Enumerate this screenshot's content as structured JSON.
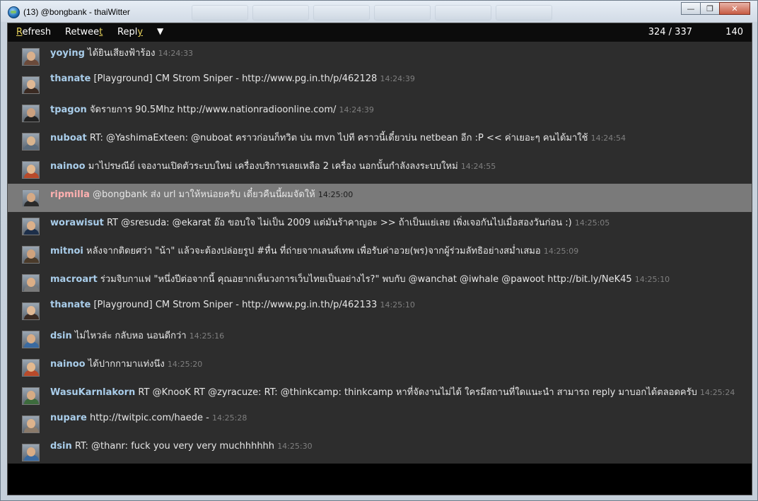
{
  "window": {
    "title": "(13) @bongbank - thaiWitter"
  },
  "toolbar": {
    "refresh": {
      "accel": "R",
      "rest": "efresh"
    },
    "retweet": {
      "pre": "Retwee",
      "accel": "t"
    },
    "reply": {
      "pre": "Repl",
      "accel": "y"
    },
    "menu_glyph": "▼",
    "count": "324 / 337",
    "chars_left": "140"
  },
  "colors": {
    "username": "#a9cdea",
    "selected_username": "#ffb0b0",
    "selected_row": "#7a7a7a",
    "accent_key": "#e8d35a"
  },
  "tweets": [
    {
      "user": "yoying",
      "text": "ได้ยินเสียงฟ้าร้อง",
      "time": "14:24:33"
    },
    {
      "user": "thanate",
      "text": "[Playground] CM Strom Sniper - http://www.pg.in.th/p/462128",
      "time": "14:24:39"
    },
    {
      "user": "tpagon",
      "text": "จัดรายการ 90.5Mhz http://www.nationradioonline.com/",
      "time": "14:24:39"
    },
    {
      "user": "nuboat",
      "text": "RT: @YashimaExteen: @nuboat คราวก่อนก็ทวิต บ่น mvn ไปที คราวนี้เดี๋ยวบ่น netbean อีก :P << ค่าเยอะๆ คนได้มาใช้",
      "time": "14:24:54"
    },
    {
      "user": "nainoo",
      "text": "มาไปรษณีย์ เจองานเปิดตัวระบบใหม่ เครื่องบริการเลยเหลือ 2 เครื่อง นอกนั้นกำลังลงระบบใหม่",
      "time": "14:24:55"
    },
    {
      "user": "ripmilla",
      "text": "@bongbank ส่ง url มาให้หน่อยครับ เดี๋ยวคืนนี้ผมจัดให้",
      "time": "14:25:00",
      "selected": true
    },
    {
      "user": "worawisut",
      "text": "RT @sresuda: @ekarat อ๊อ ขอบใจ ไม่เป็น 2009 แต่มันร้าคาญอะ >> ถ้าเป็นแย่เลย เพิ่งเจอกันไปเมื่อสองวันก่อน :)",
      "time": "14:25:05"
    },
    {
      "user": "mitnoi",
      "text": "หลังจากติดยศว่า \"น้า\" แล้วจะต้องปล่อยรูป #หื่น ที่ถ่ายจากเลนส์เทพ เพื่อรับค่าอวย(พร)จากผู้ร่วมลัทธิอย่างสม่ำเสมอ",
      "time": "14:25:09"
    },
    {
      "user": "macroart",
      "text": "ร่วมจิบกาแฟ \"หนึ่งปีต่อจากนี้ คุณอยากเห็นวงการเว็บไทยเป็นอย่างไร?\" พบกับ @wanchat @iwhale @pawoot http://bit.ly/NeK45",
      "time": "14:25:10"
    },
    {
      "user": "thanate",
      "text": "[Playground] CM Strom Sniper - http://www.pg.in.th/p/462133",
      "time": "14:25:10"
    },
    {
      "user": "dsin",
      "text": "ไม่ไหวล่ะ กลับหอ นอนดีกว่า",
      "time": "14:25:16"
    },
    {
      "user": "nainoo",
      "text": "ได้ปากกามาแท่งนึง",
      "time": "14:25:20"
    },
    {
      "user": "WasuKarnlakorn",
      "text": "RT @KnooK RT @zyracuze: RT: @thinkcamp: thinkcamp หาที่จัดงานไม่ได้ ใครมีสถานที่ใดแนะนำ สามารถ reply มาบอกได้ตลอดครับ",
      "time": "14:25:24"
    },
    {
      "user": "nupare",
      "text": "http://twitpic.com/haede -",
      "time": "14:25:28"
    },
    {
      "user": "dsin",
      "text": "RT: @thanr: fuck you very very muchhhhhh",
      "time": "14:25:30"
    }
  ]
}
